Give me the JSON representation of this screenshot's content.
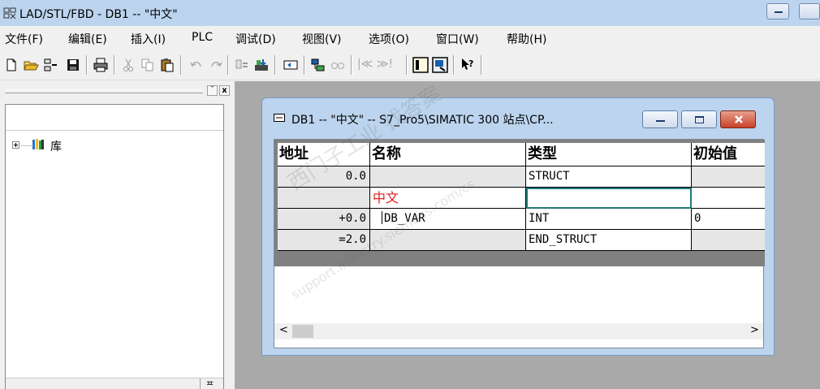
{
  "window": {
    "title": "LAD/STL/FBD  - DB1 -- \"中文\""
  },
  "menu": {
    "items": [
      {
        "label": "文件(F)"
      },
      {
        "label": "编辑(E)"
      },
      {
        "label": "插入(I)"
      },
      {
        "label": "PLC"
      },
      {
        "label": "调试(D)"
      },
      {
        "label": "视图(V)"
      },
      {
        "label": "选项(O)"
      },
      {
        "label": "窗口(W)"
      },
      {
        "label": "帮助(H)"
      }
    ]
  },
  "toolbar": {
    "icons": [
      "new-icon",
      "open-icon",
      "accessible-nodes-icon",
      "save-icon",
      "print-icon",
      "cut-icon",
      "copy-icon",
      "paste-icon",
      "undo-icon",
      "redo-icon",
      "monitor-icon",
      "download-icon",
      "insert-network-icon",
      "display-icon",
      "glasses-icon",
      "step-icon",
      "overview-icon",
      "details-icon",
      "help-icon"
    ],
    "step_label": "|≪ ≫!"
  },
  "left_panel": {
    "tree_item_label": "库",
    "close_glyph": "x",
    "scroll_glyph": "¯",
    "bottom_glyph": "ᄑ"
  },
  "db_window": {
    "title": "DB1 -- \"中文\" -- S7_Pro5\\SIMATIC 300 站点\\CP..."
  },
  "table": {
    "headers": [
      "地址",
      "名称",
      "类型",
      "初始值"
    ],
    "rows": [
      {
        "address": "0.0",
        "name": "",
        "type": "STRUCT",
        "initial": ""
      },
      {
        "address": "",
        "name": "中文",
        "type": "",
        "initial": ""
      },
      {
        "address": "+0.0",
        "name": "DB_VAR",
        "type": "INT",
        "initial": "0"
      },
      {
        "address": "=2.0",
        "name": "",
        "type": "END_STRUCT",
        "initial": ""
      }
    ]
  },
  "scroll": {
    "left_arrow": "<",
    "right_arrow": ">"
  },
  "watermark": {
    "line1": "西门子工业 找答案",
    "line2": "support.industry.siemens.com/cs"
  }
}
